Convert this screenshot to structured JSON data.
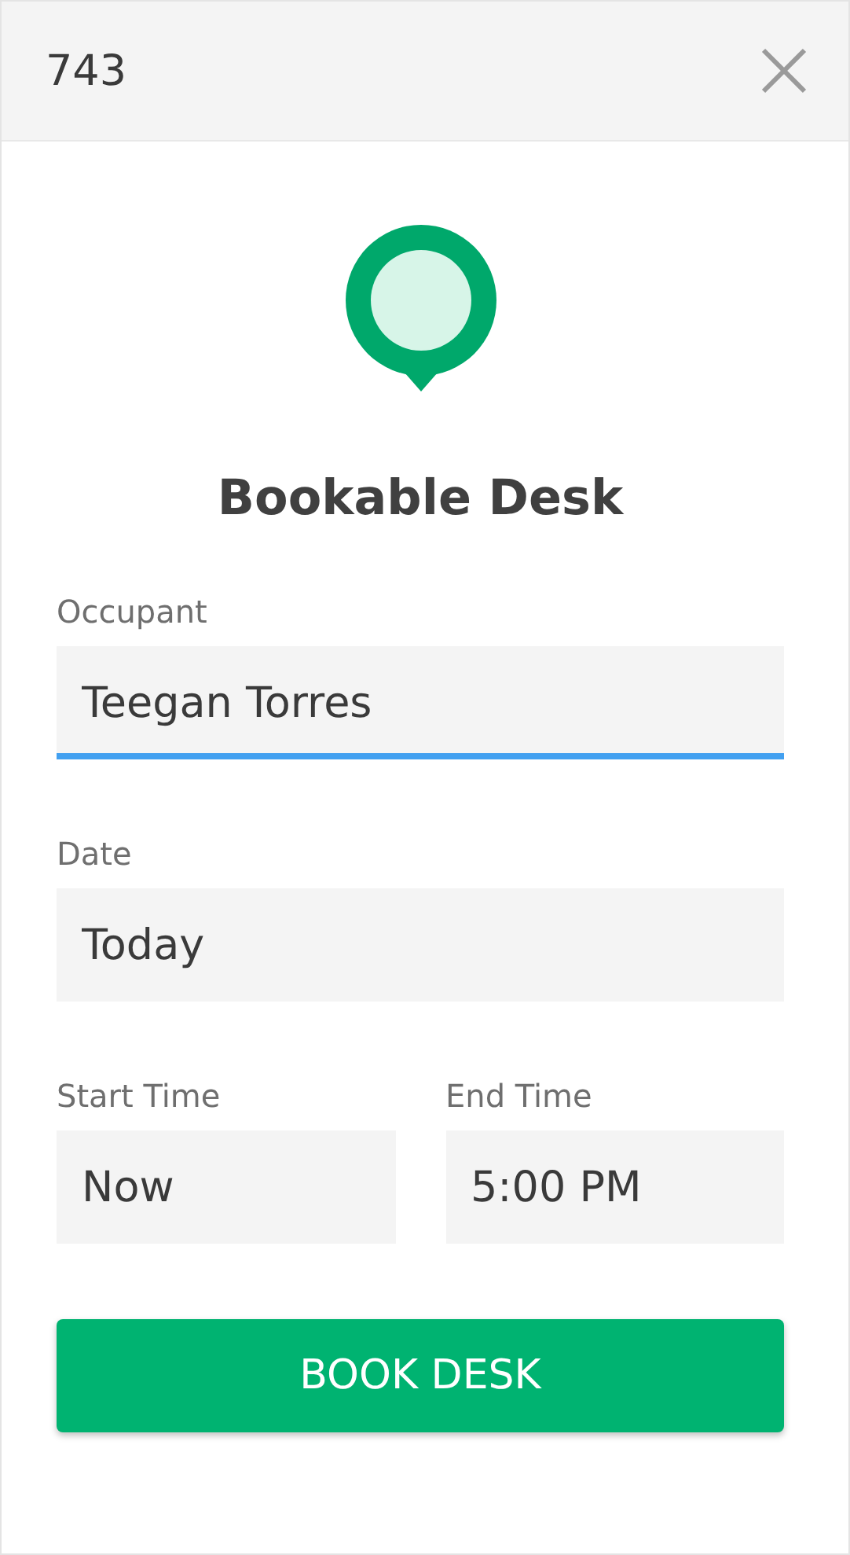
{
  "header": {
    "title": "743"
  },
  "title": "Bookable Desk",
  "fields": [
    {
      "label": "Occupant",
      "value": "Teegan Torres",
      "focused": true,
      "kind": "full"
    },
    {
      "label": "Date",
      "value": "Today",
      "focused": false,
      "kind": "full"
    },
    {
      "label": "Start Time",
      "value": "Now",
      "focused": false,
      "kind": "half"
    },
    {
      "label": "End Time",
      "value": "5:00 PM",
      "focused": false,
      "kind": "half"
    }
  ],
  "button": "BOOK DESK"
}
